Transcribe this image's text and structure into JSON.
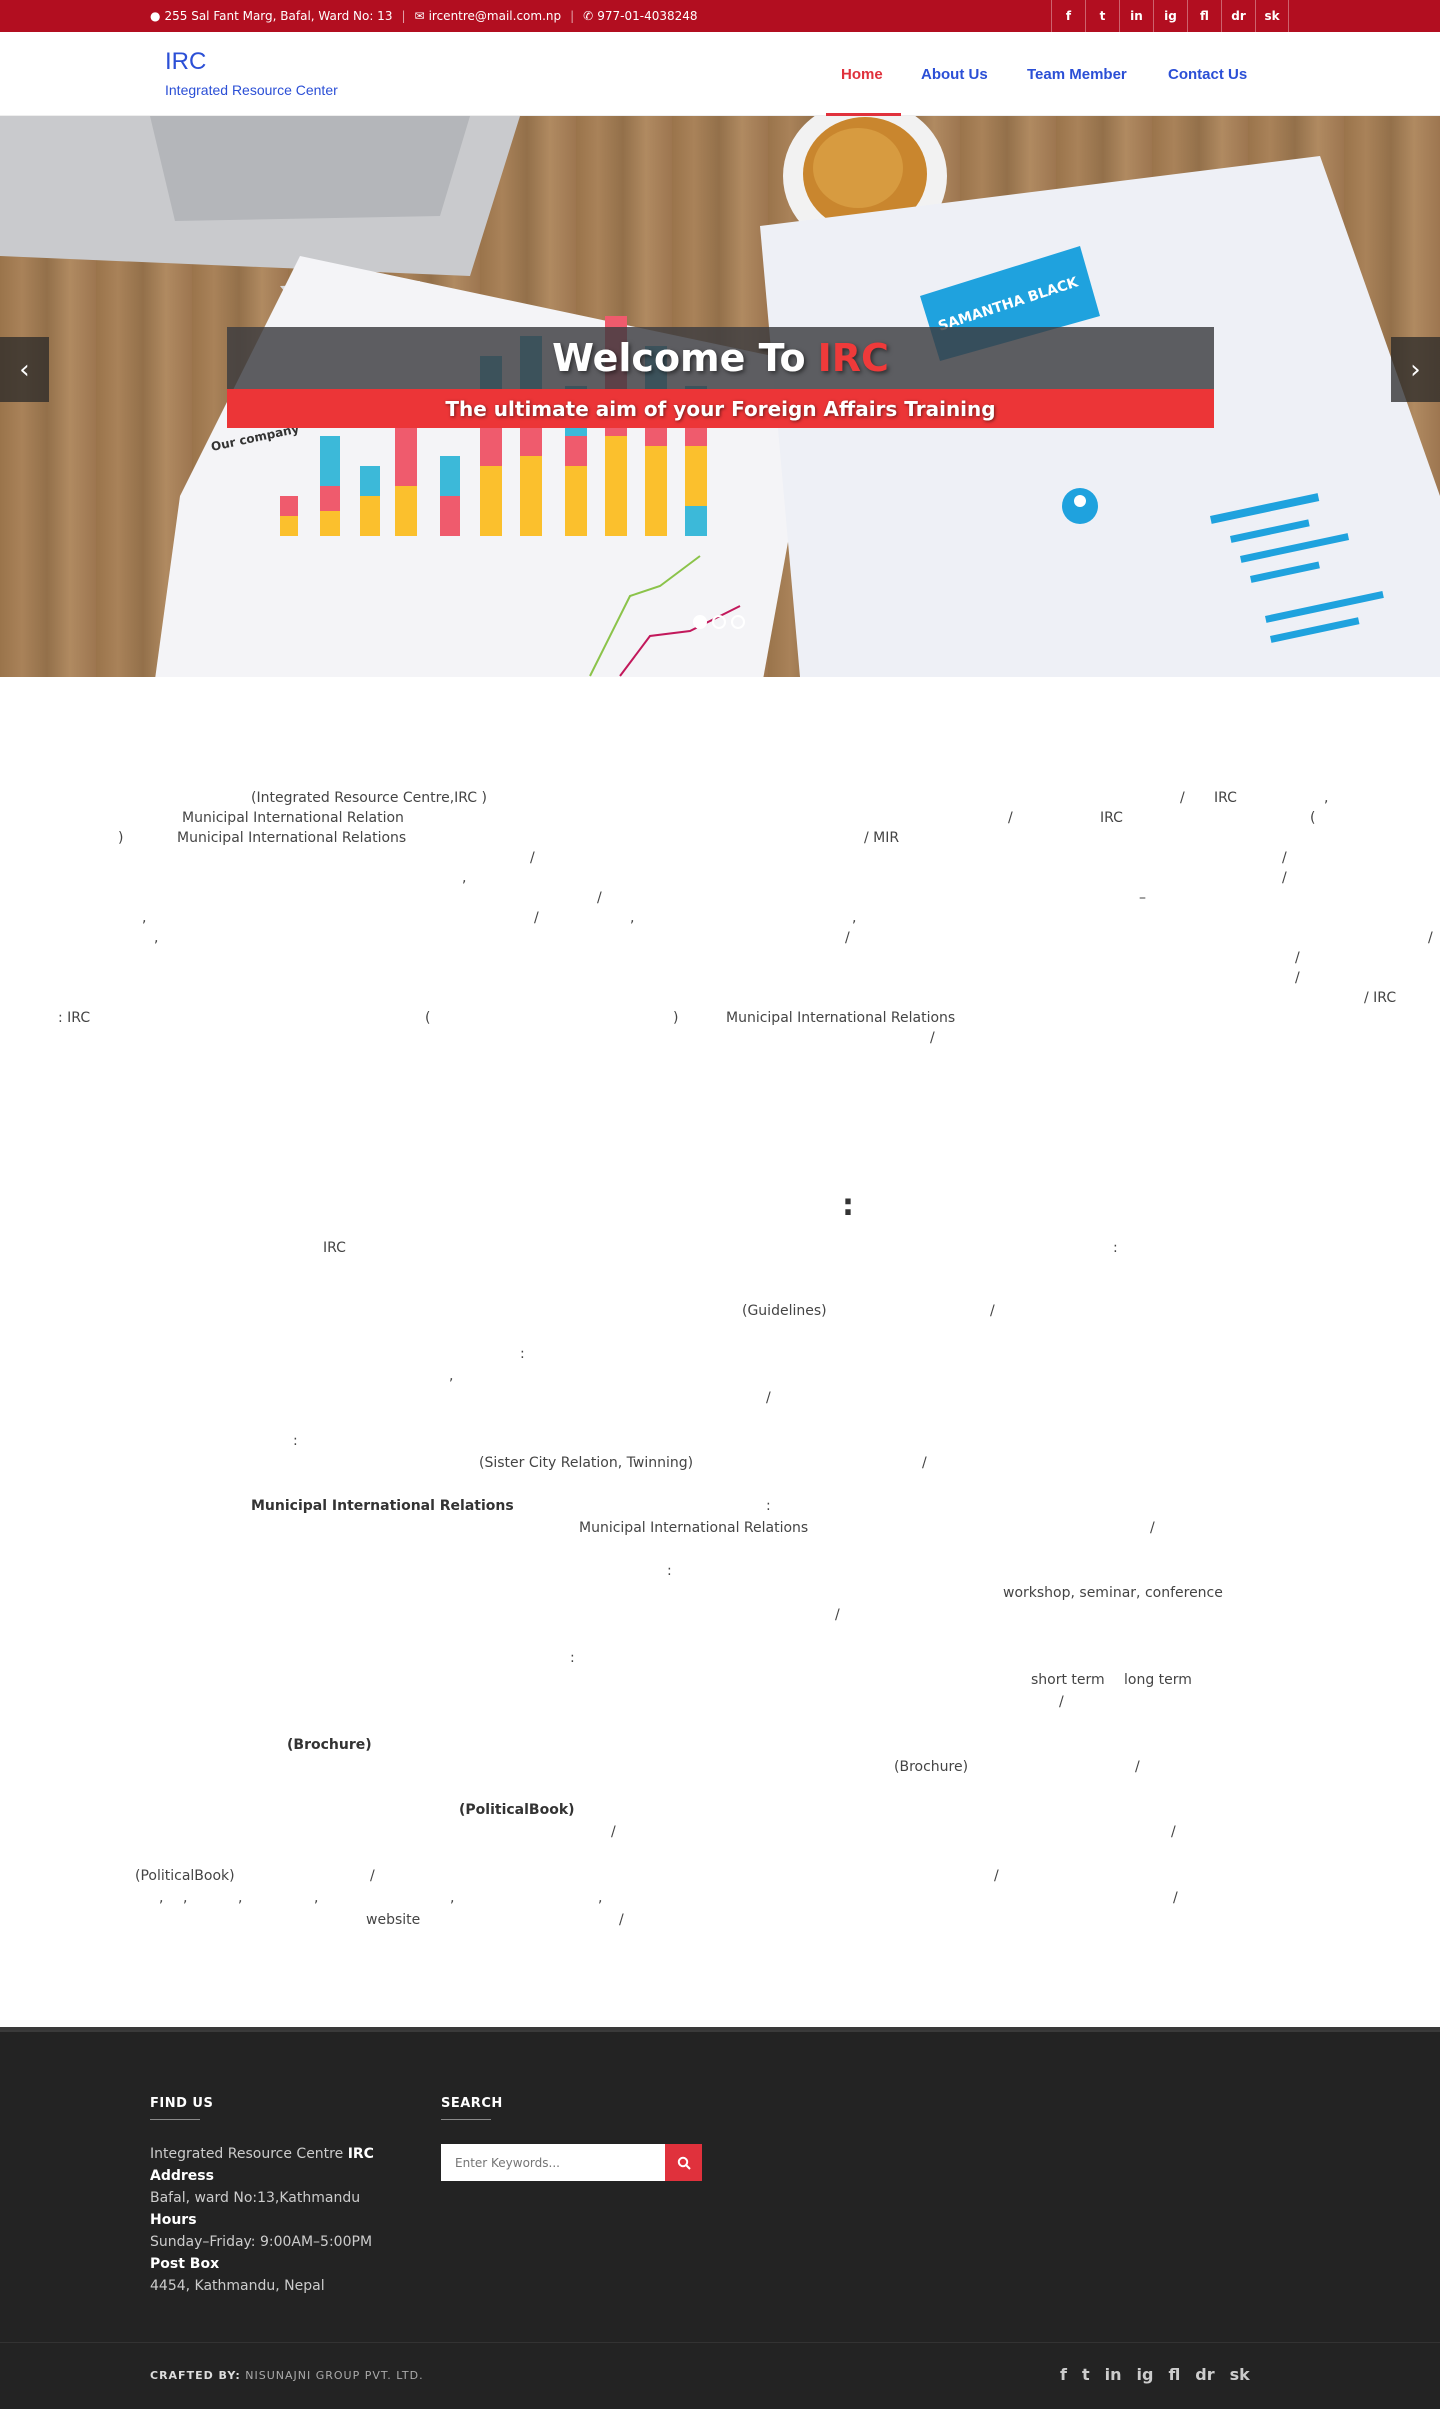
{
  "topbar": {
    "address": "255 Sal Fant Marg, Bafal, Ward No: 13",
    "email": "ircentre@mail.com.np",
    "phone": "977-01-4038248",
    "social": [
      "f",
      "t",
      "in",
      "ig",
      "fl",
      "dr",
      "sk"
    ]
  },
  "header": {
    "brand_name": "IRC",
    "brand_subtitle": "Integrated Resource Center",
    "nav": [
      "Home",
      "About Us",
      "Team Member",
      "Contact Us"
    ],
    "active_nav": "Home",
    "accent_color": "#e0313c",
    "link_color": "#2b4fd6"
  },
  "hero": {
    "title_prefix": "Welcome To",
    "title_highlight": "IRC",
    "subtitle": "The ultimate aim of your Foreign Affairs Training",
    "chart_label": "Our company",
    "resume_name": "SAMANTHA BLACK",
    "slides": 3,
    "active_slide": 1
  },
  "intro_fragments": [
    "(Integrated Resource Centre,IRC )",
    "/",
    "IRC",
    ",",
    "Municipal International Relation",
    "/",
    "IRC",
    "(",
    ")",
    "Municipal International Relations",
    "/ MIR",
    "/",
    "/",
    ",",
    "/",
    "/",
    "–",
    ",",
    "/",
    ",",
    ",",
    ",",
    "/",
    "/",
    "/",
    "/",
    "/ IRC",
    ": IRC",
    "(",
    ")",
    "Municipal International Relations",
    "/"
  ],
  "services": {
    "colon": ":",
    "fragments": [
      "IRC",
      ":",
      "(Guidelines)",
      "/",
      ":",
      ",",
      "/",
      ":",
      "(Sister City Relation, Twinning)",
      "/",
      "Municipal International Relations",
      ":",
      "Municipal International Relations",
      "/",
      ":",
      "workshop, seminar, conference",
      "/",
      ":",
      "short term",
      "long term",
      "/",
      "(Brochure)",
      "(Brochure)",
      "/",
      "(PoliticalBook)",
      "/",
      "/",
      "(PoliticalBook)",
      "/",
      "/",
      ",",
      ",",
      ",",
      ",",
      ",",
      ",",
      "/",
      "website",
      "/"
    ]
  },
  "footer": {
    "find_us_heading": "FIND US",
    "search_heading": "SEARCH",
    "org_name": "Integrated Resource Centre",
    "org_abbr": "IRC",
    "address_label": "Address",
    "address": "Bafal, ward No:13,Kathmandu",
    "hours_label": "Hours",
    "hours": "Sunday–Friday: 9:00AM–5:00PM",
    "postbox_label": "Post Box",
    "postbox": "4454, Kathmandu, Nepal",
    "search_placeholder": "Enter Keywords...",
    "crafted_by_label": "CRAFTED BY:",
    "crafted_by": "NISUNAJNI GROUP PVT. LTD."
  }
}
